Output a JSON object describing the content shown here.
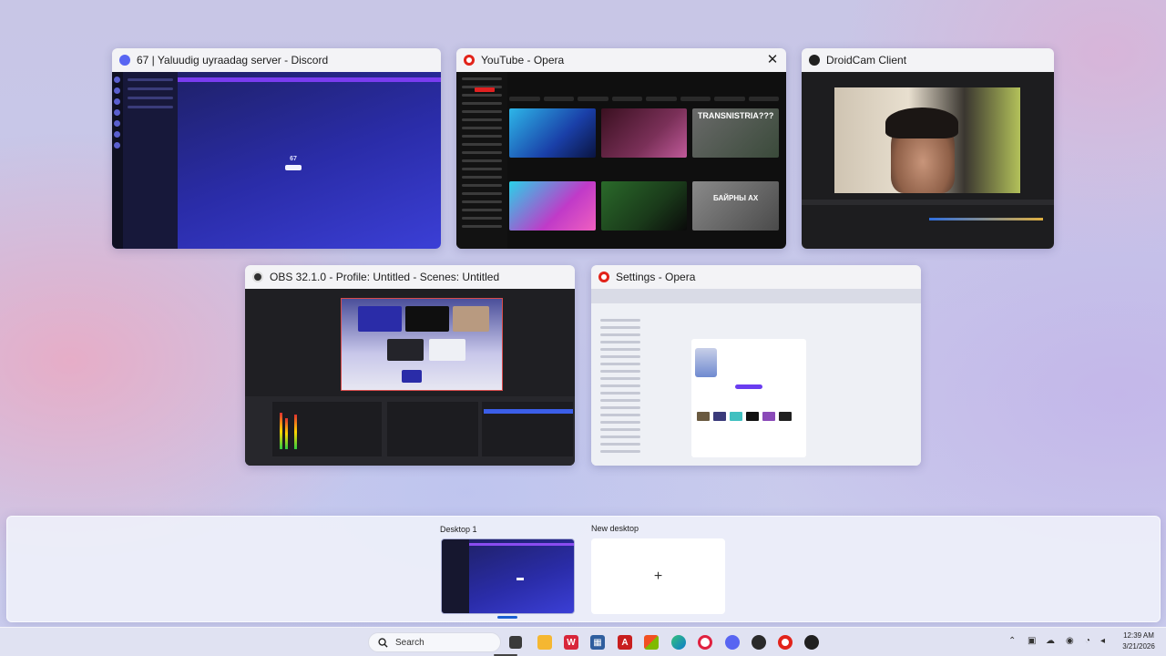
{
  "windows": [
    {
      "title": "67 | Yaluudig uyraadag server - Discord",
      "icon": "discord-icon",
      "icon_color": "#5865F2"
    },
    {
      "title": "YouTube - Opera",
      "icon": "opera-icon",
      "icon_color": "#E2231A",
      "close_label": "✕"
    },
    {
      "title": "DroidCam Client",
      "icon": "droidcam-icon",
      "icon_color": "#202020"
    },
    {
      "title": "OBS 32.1.0 - Profile: Untitled - Scenes: Untitled",
      "icon": "obs-icon",
      "icon_color": "#303030"
    },
    {
      "title": "Settings - Opera",
      "icon": "opera-icon",
      "icon_color": "#E2231A"
    }
  ],
  "thumbs": {
    "discord_center_number": "67",
    "youtube_tile_text_1": "TRANSNISTRIA???",
    "youtube_tile_text_2": "БАЙРНЫ АХ"
  },
  "desktops": {
    "items": [
      {
        "label": "Desktop 1",
        "active": true
      },
      {
        "label": "New desktop",
        "add_symbol": "+"
      }
    ]
  },
  "taskbar": {
    "search_placeholder": "Search",
    "pinned": [
      {
        "name": "start-icon",
        "glyph": "",
        "color": "#0078D4"
      },
      {
        "name": "task-view-icon",
        "glyph": "",
        "color": "#444444"
      },
      {
        "name": "file-explorer-icon",
        "glyph": "",
        "color": "#F5B731"
      },
      {
        "name": "wps-icon",
        "glyph": "W",
        "color": "#D8263A"
      },
      {
        "name": "calculator-icon",
        "glyph": "",
        "color": "#2F5E9E"
      },
      {
        "name": "acrobat-icon",
        "glyph": "A",
        "color": "#D02525"
      },
      {
        "name": "store-icon",
        "glyph": "",
        "color": "#3B8BDA"
      },
      {
        "name": "edge-icon",
        "glyph": "",
        "color": "#0C7BCD"
      },
      {
        "name": "opera-gx-icon",
        "glyph": "O",
        "color": "#E0213F"
      },
      {
        "name": "discord-icon",
        "glyph": "",
        "color": "#5865F2"
      },
      {
        "name": "obs-icon",
        "glyph": "",
        "color": "#2A2A2A"
      },
      {
        "name": "opera-icon",
        "glyph": "O",
        "color": "#E2231A"
      },
      {
        "name": "droidcam-icon",
        "glyph": "",
        "color": "#202020"
      }
    ],
    "clock_time": "12:39 AM",
    "clock_date": "3/21/2026"
  }
}
